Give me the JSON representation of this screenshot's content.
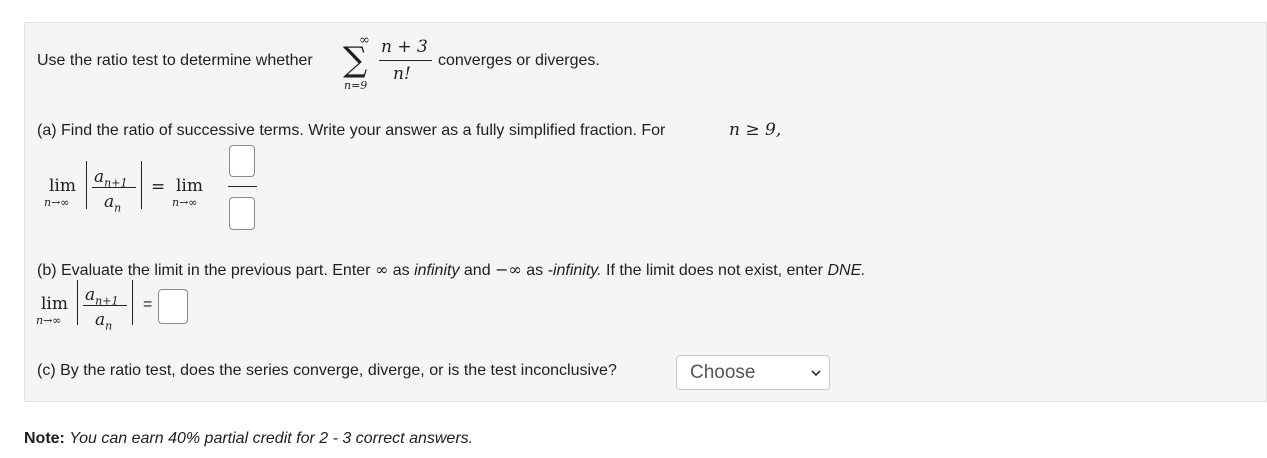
{
  "question": {
    "intro_before": "Use the ratio test to determine whether",
    "intro_after": "converges or diverges.",
    "series": {
      "symbol": "∑",
      "upper": "∞",
      "lower": "n=9",
      "numerator": "n + 3",
      "denominator": "n!"
    }
  },
  "part_a": {
    "text": "(a) Find the ratio of successive terms. Write your answer as a fully simplified fraction. For",
    "condition": "n ≥ 9,",
    "lim": "lim",
    "lim_sub": "n→∞",
    "ratio_num": "a",
    "ratio_num_sub": "n+1",
    "ratio_den": "a",
    "ratio_den_sub": "n",
    "equals": "=",
    "lim2": "lim",
    "lim2_sub": "n→∞",
    "numerator_answer": "",
    "denominator_answer": ""
  },
  "part_b": {
    "text_1": "(b) Evaluate the limit in the previous part. Enter",
    "infinity_symbol": "∞",
    "text_2": "as",
    "infinity_word": "infinity",
    "text_3": "and",
    "neg_infinity_symbol": "−∞",
    "text_4": "as",
    "neg_infinity_word": "-infinity.",
    "text_5": "If the limit does not exist, enter",
    "dne": "DNE.",
    "lim": "lim",
    "lim_sub": "n→∞",
    "ratio_num": "a",
    "ratio_num_sub": "n+1",
    "ratio_den": "a",
    "ratio_den_sub": "n",
    "equals": "=",
    "answer": ""
  },
  "part_c": {
    "text": "(c) By the ratio test, does the series converge, diverge, or is the test inconclusive?",
    "select_value": "Choose"
  },
  "note": {
    "label": "Note:",
    "text": "You can earn 40% partial credit for 2 - 3 correct answers."
  }
}
